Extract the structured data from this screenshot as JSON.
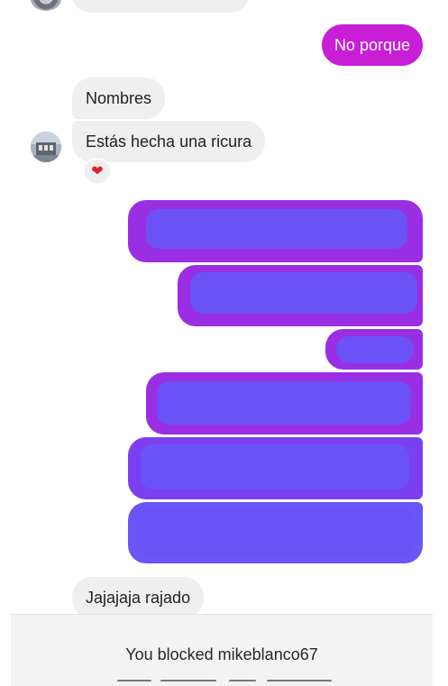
{
  "conversation": {
    "outgoing_top": "No porque",
    "incoming": [
      {
        "text": "Nombres"
      },
      {
        "text": "Estás hecha una ricura"
      },
      {
        "text": "Jajajaja rajado"
      }
    ],
    "reaction_icon": "heart-icon",
    "reaction_glyph": "❤",
    "redacted_messages": 6,
    "colors": {
      "outgoing_bubble": "#c81ed6",
      "incoming_bubble": "#efefef",
      "redaction_purple": "#9a2ee3",
      "redaction_blue": "#6a52f7"
    }
  },
  "footer": {
    "blocked_text": "You blocked mikeblanco67"
  }
}
